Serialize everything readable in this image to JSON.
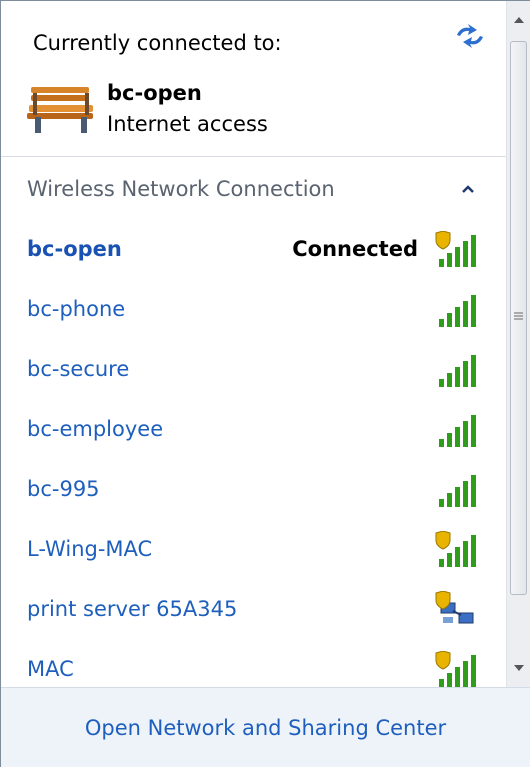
{
  "current": {
    "title": "Currently connected to:",
    "network_name": "bc-open",
    "network_status": "Internet access"
  },
  "section": {
    "title": "Wireless Network Connection"
  },
  "networks": [
    {
      "name": "bc-open",
      "status": "Connected",
      "icon": "signal-secured-icon",
      "bold": true
    },
    {
      "name": "bc-phone",
      "status": "",
      "icon": "signal-icon",
      "bold": false
    },
    {
      "name": "bc-secure",
      "status": "",
      "icon": "signal-icon",
      "bold": false
    },
    {
      "name": "bc-employee",
      "status": "",
      "icon": "signal-icon",
      "bold": false
    },
    {
      "name": "bc-995",
      "status": "",
      "icon": "signal-icon",
      "bold": false
    },
    {
      "name": "L-Wing-MAC",
      "status": "",
      "icon": "signal-secured-icon",
      "bold": false
    },
    {
      "name": "print server 65A345",
      "status": "",
      "icon": "adhoc-secured-icon",
      "bold": false
    },
    {
      "name": "MAC",
      "status": "",
      "icon": "signal-secured-icon",
      "bold": false
    }
  ],
  "footer": {
    "link": "Open Network and Sharing Center"
  },
  "colors": {
    "link": "#1e5fbd",
    "signal": "#2f9c1a",
    "shield": "#e8b400"
  }
}
